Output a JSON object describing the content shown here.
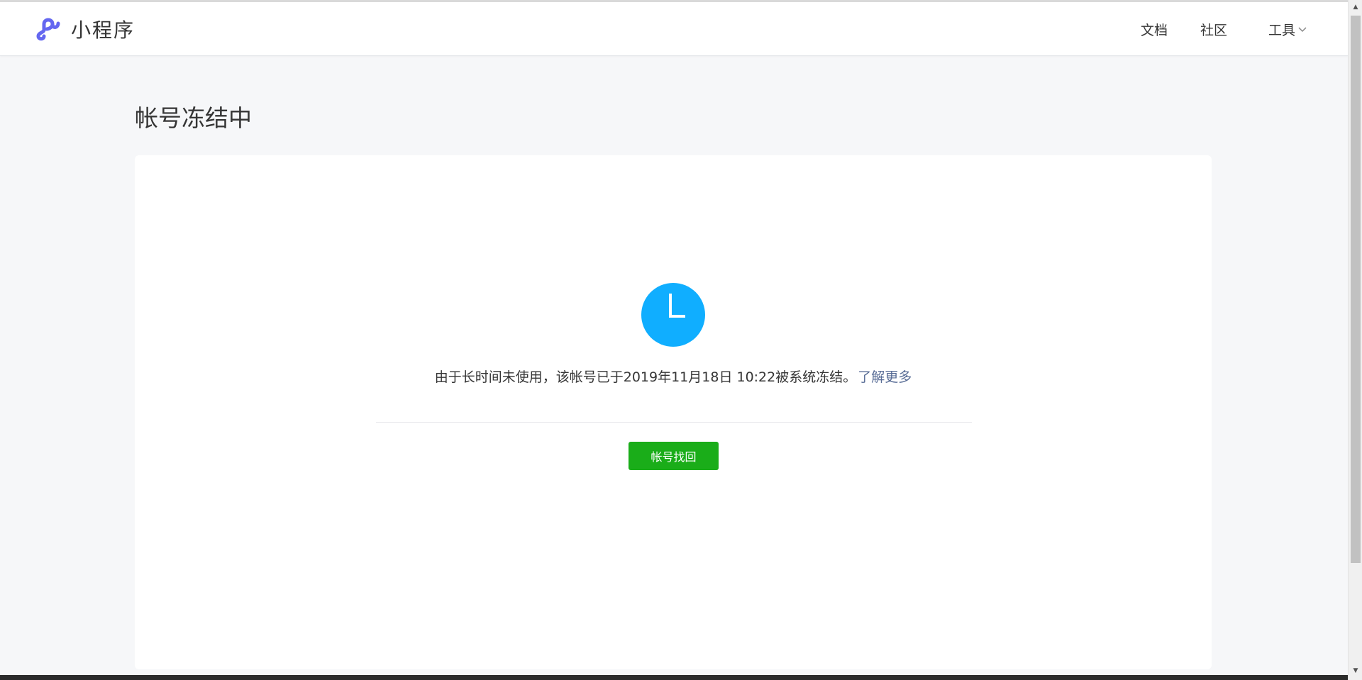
{
  "header": {
    "logo_text": "小程序",
    "brand_color": "#6467f0",
    "nav": {
      "docs": "文档",
      "community": "社区",
      "tools": "工具"
    }
  },
  "page": {
    "title": "帐号冻结中"
  },
  "notice": {
    "icon": "clock-icon",
    "icon_color": "#10aeff",
    "message": "由于长时间未使用，该帐号已于2019年11月18日 10:22被系统冻结。",
    "learn_more": "了解更多",
    "link_color": "#576b95"
  },
  "actions": {
    "recover_label": "帐号找回",
    "recover_color": "#1aad19"
  }
}
